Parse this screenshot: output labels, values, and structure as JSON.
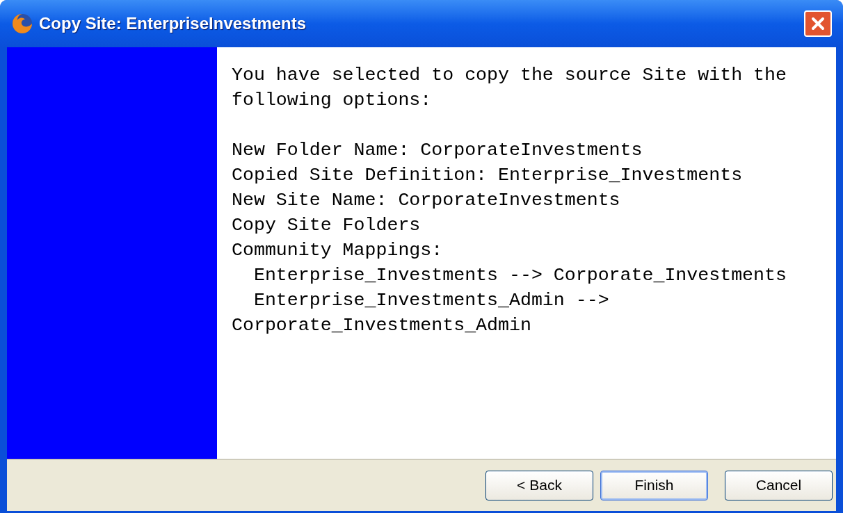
{
  "window": {
    "title": "Copy Site: EnterpriseInvestments"
  },
  "summary": {
    "intro": "You have selected to copy the source Site with the following options:",
    "lines": [
      "New Folder Name: CorporateInvestments",
      "Copied Site Definition: Enterprise_Investments",
      "New Site Name: CorporateInvestments",
      "Copy Site Folders",
      "Community Mappings:",
      "  Enterprise_Investments --> Corporate_Investments",
      "  Enterprise_Investments_Admin --> Corporate_Investments_Admin"
    ]
  },
  "buttons": [
    {
      "label": "< Back",
      "focused": false
    },
    {
      "label": "Finish",
      "focused": true
    },
    {
      "label": "Cancel",
      "focused": false
    }
  ]
}
